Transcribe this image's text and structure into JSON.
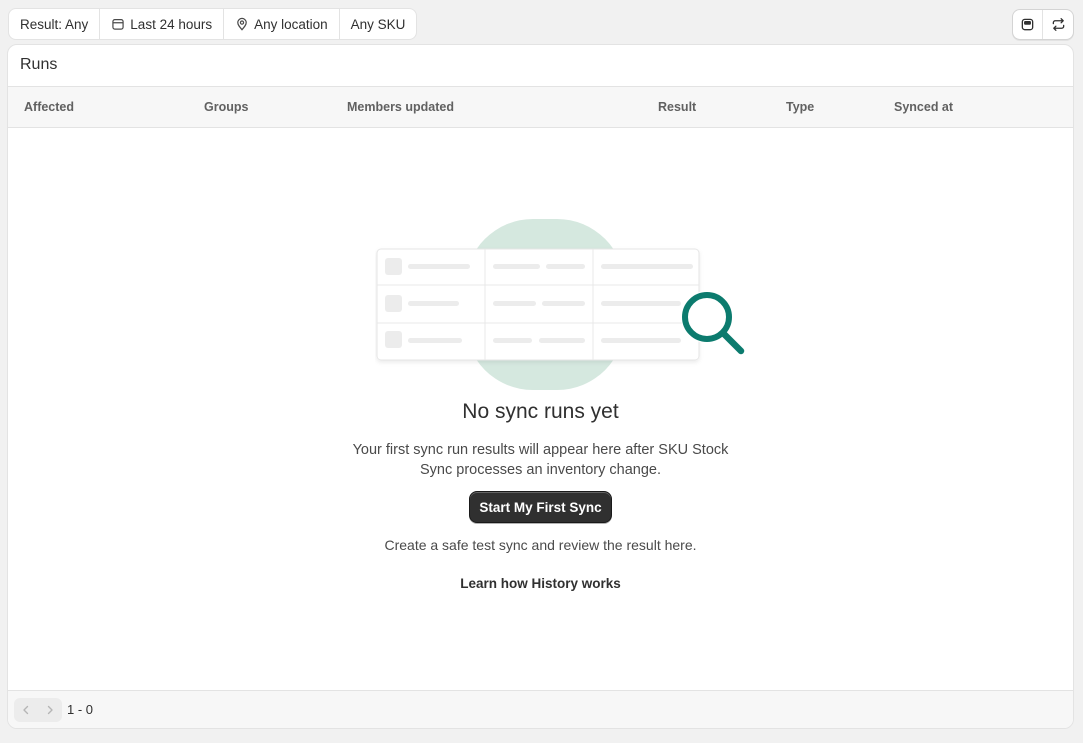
{
  "filters": [
    {
      "label": "Result: Any",
      "icon": ""
    },
    {
      "label": "Last 24 hours",
      "icon": "calendar-icon"
    },
    {
      "label": "Any location",
      "icon": "location-pin-icon"
    },
    {
      "label": "Any SKU",
      "icon": ""
    }
  ],
  "toolbar": {
    "icons": [
      "columns-icon",
      "sync-icon"
    ]
  },
  "card": {
    "title": "Runs",
    "columns": [
      "Affected",
      "Groups",
      "Members updated",
      "Result",
      "Type",
      "Synced at"
    ]
  },
  "empty_state": {
    "title": "No sync runs yet",
    "description_line1": "Your first sync run results will appear here after SKU Stock",
    "description_line2": "Sync processes an inventory change.",
    "primary_action": "Start My First Sync",
    "helper": "Create a safe test sync and review the result here.",
    "learn_link": "Learn how History works"
  },
  "pagination": {
    "range": "1 - 0"
  },
  "colors": {
    "accent": "#0c7b6e",
    "illustration_blob": "#d5e8df",
    "primary_button": "#303030"
  }
}
